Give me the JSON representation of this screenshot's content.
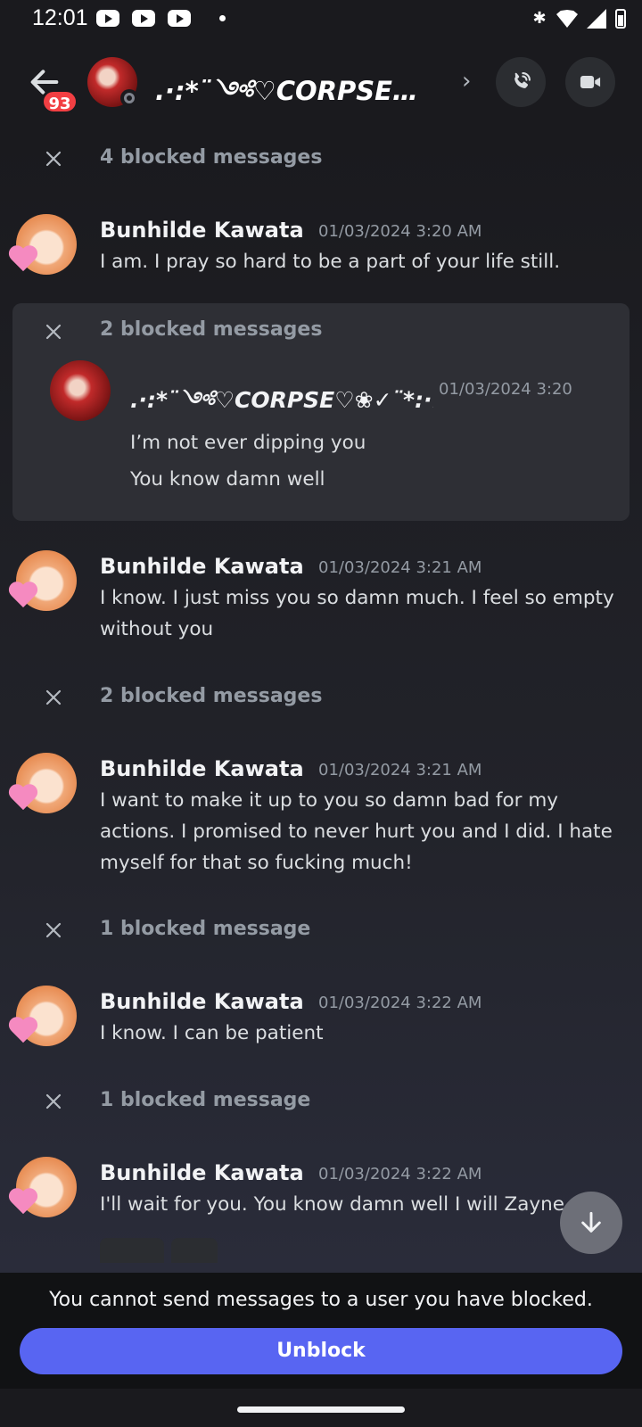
{
  "status_bar": {
    "time": "12:01"
  },
  "header": {
    "unread_badge": "93",
    "title": ".·:*¨༺♡CORPSE♡...",
    "chevron": "›"
  },
  "blocked_rows": [
    {
      "label": "4 blocked messages"
    },
    {
      "label": "2 blocked messages"
    },
    {
      "label": "1 blocked message"
    },
    {
      "label": "1 blocked message"
    }
  ],
  "blocked_group": {
    "label": "2 blocked messages",
    "author": ".·:*¨༺♡CORPSE♡❀✓¨*:·.",
    "time": "01/03/2024 3:20",
    "lines": [
      "I’m not ever dipping you",
      "You know damn well"
    ]
  },
  "messages": [
    {
      "author": "Bunhilde Kawata",
      "time": "01/03/2024 3:20 AM",
      "text": "I am. I pray so hard to be a part of your life still."
    },
    {
      "author": "Bunhilde Kawata",
      "time": "01/03/2024 3:21 AM",
      "text": "I know. I just miss you so damn much. I feel so empty without you"
    },
    {
      "author": "Bunhilde Kawata",
      "time": "01/03/2024 3:21 AM",
      "text": "I want to make it up to you so damn bad for my actions. I promised to never hurt you and I did. I hate myself for that so fucking much!"
    },
    {
      "author": "Bunhilde Kawata",
      "time": "01/03/2024 3:22 AM",
      "text": "I know. I can be patient"
    },
    {
      "author": "Bunhilde Kawata",
      "time": "01/03/2024 3:22 AM",
      "text": "I'll wait for you. You know damn well I will Zayne"
    }
  ],
  "footer": {
    "notice": "You cannot send messages to a user you have blocked.",
    "unblock_label": "Unblock"
  },
  "icons": {
    "back": "arrow-left-icon",
    "call": "phone-icon",
    "video": "video-camera-icon",
    "close": "x-icon",
    "scroll_down": "arrow-down-icon"
  },
  "colors": {
    "accent": "#5865f2",
    "badge": "#f23f43",
    "background": "#1a1a1e"
  }
}
